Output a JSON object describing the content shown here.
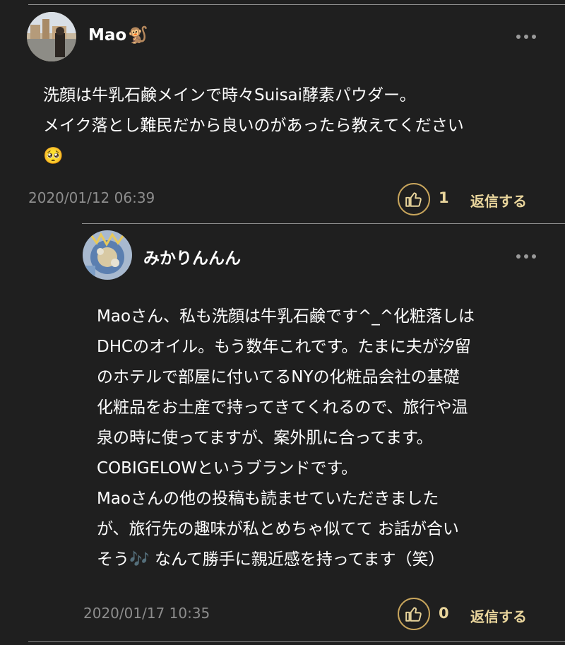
{
  "comments": [
    {
      "username": "Mao",
      "username_emoji": "🐒",
      "body_lines": [
        "洗顔は牛乳石鹸メインで時々Suisai酵素パウダー。",
        "メイク落とし難民だから良いのがあったら教えてください",
        "🥺"
      ],
      "date": "2020/01/12 06:39",
      "like_count": "1",
      "reply_label": "返信する"
    },
    {
      "username": "みかりんんん",
      "body_lines": [
        "Maoさん、私も洗顔は牛乳石鹸です^_^化粧落しは",
        "DHCのオイル。もう数年これです。たまに夫が汐留",
        "のホテルで部屋に付いてるNYの化粧品会社の基礎",
        "化粧品をお土産で持ってきてくれるので、旅行や温",
        "泉の時に使ってますが、案外肌に合ってます。",
        "COBIGELOWというブランドです。",
        "Maoさんの他の投稿も読ませていただきました",
        "が、旅行先の趣味が私とめちゃ似てて お話が合い",
        "そう🎶  なんて勝手に親近感を持ってます（笑）"
      ],
      "date": "2020/01/17 10:35",
      "like_count": "0",
      "reply_label": "返信する"
    }
  ],
  "colors": {
    "background": "#1f1f1f",
    "accent_gold": "#c8a55c",
    "date_gray": "#8d8d8d"
  }
}
